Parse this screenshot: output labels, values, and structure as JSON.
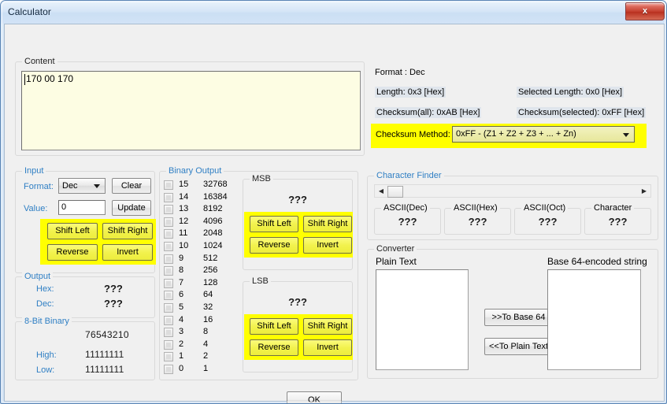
{
  "window": {
    "title": "Calculator",
    "close_label": "x"
  },
  "content": {
    "group_label": "Content",
    "text": "170 00 170"
  },
  "format": {
    "format_line": "Format : Dec",
    "length_label": "Length:  0x3 [Hex]",
    "selected_length_label": "Selected Length:  0x0 [Hex]",
    "checksum_all_label": "Checksum(all):  0xAB [Hex]",
    "checksum_selected_label": "Checksum(selected):  0xFF [Hex]",
    "checksum_method_label": "Checksum Method:",
    "checksum_method_value": "0xFF - (Z1 + Z2 + Z3 + ... + Zn)"
  },
  "input": {
    "group_label": "Input",
    "format_label": "Format:",
    "format_value": "Dec",
    "clear_label": "Clear",
    "value_label": "Value:",
    "value_text": "0",
    "update_label": "Update",
    "shift_left_label": "Shift Left",
    "shift_right_label": "Shift Right",
    "reverse_label": "Reverse",
    "invert_label": "Invert"
  },
  "output": {
    "group_label": "Output",
    "hex_label": "Hex:",
    "hex_value": "???",
    "dec_label": "Dec:",
    "dec_value": "???"
  },
  "bit8": {
    "group_label": "8-Bit Binary",
    "header": "76543210",
    "high_label": "High:",
    "high_value": "11111111",
    "low_label": "Low:",
    "low_value": "11111111"
  },
  "binary_output": {
    "group_label": "Binary Output",
    "rows": [
      {
        "index": "15",
        "value": "32768",
        "checked": false
      },
      {
        "index": "14",
        "value": "16384",
        "checked": false
      },
      {
        "index": "13",
        "value": "8192",
        "checked": false
      },
      {
        "index": "12",
        "value": "4096",
        "checked": false
      },
      {
        "index": "11",
        "value": "2048",
        "checked": false
      },
      {
        "index": "10",
        "value": "1024",
        "checked": false
      },
      {
        "index": "9",
        "value": "512",
        "checked": false
      },
      {
        "index": "8",
        "value": "256",
        "checked": false
      },
      {
        "index": "7",
        "value": "128",
        "checked": false
      },
      {
        "index": "6",
        "value": "64",
        "checked": false
      },
      {
        "index": "5",
        "value": "32",
        "checked": false
      },
      {
        "index": "4",
        "value": "16",
        "checked": false
      },
      {
        "index": "3",
        "value": "8",
        "checked": false
      },
      {
        "index": "2",
        "value": "4",
        "checked": false
      },
      {
        "index": "1",
        "value": "2",
        "checked": false
      },
      {
        "index": "0",
        "value": "1",
        "checked": false
      }
    ]
  },
  "msb": {
    "group_label": "MSB",
    "value": "???",
    "shift_left_label": "Shift Left",
    "shift_right_label": "Shift Right",
    "reverse_label": "Reverse",
    "invert_label": "Invert"
  },
  "lsb": {
    "group_label": "LSB",
    "value": "???",
    "shift_left_label": "Shift Left",
    "shift_right_label": "Shift Right",
    "reverse_label": "Reverse",
    "invert_label": "Invert"
  },
  "character_finder": {
    "group_label": "Character Finder",
    "left_arrow": "◀",
    "right_arrow": "▶",
    "fields": [
      {
        "label": "ASCII(Dec)",
        "value": "???"
      },
      {
        "label": "ASCII(Hex)",
        "value": "???"
      },
      {
        "label": "ASCII(Oct)",
        "value": "???"
      },
      {
        "label": "Character",
        "value": "???"
      }
    ]
  },
  "converter": {
    "group_label": "Converter",
    "plain_text_label": "Plain Text",
    "plain_text_value": "",
    "base64_label": "Base 64-encoded string",
    "base64_value": "",
    "to_base64_label": ">>To Base 64",
    "to_plain_text_label": "<<To Plain Text"
  },
  "footer": {
    "ok_label": "OK"
  },
  "colors": {
    "highlight_yellow": "#ffff00",
    "group_label_blue": "#2f7fc4",
    "content_background": "#fdfde3",
    "label_highlight": "#dfe5ec"
  }
}
